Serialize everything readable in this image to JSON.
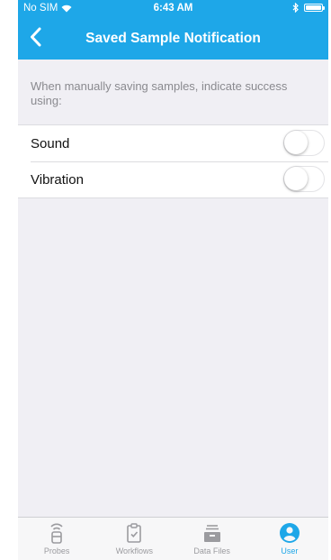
{
  "statusbar": {
    "carrier": "No SIM",
    "time": "6:43 AM"
  },
  "navbar": {
    "title": "Saved Sample Notification"
  },
  "section": {
    "header": "When manually saving samples, indicate success using:"
  },
  "settings": [
    {
      "label": "Sound",
      "enabled": false
    },
    {
      "label": "Vibration",
      "enabled": false
    }
  ],
  "tabs": [
    {
      "label": "Probes",
      "icon": "probe-icon",
      "active": false
    },
    {
      "label": "Workflows",
      "icon": "clipboard-icon",
      "active": false
    },
    {
      "label": "Data Files",
      "icon": "files-icon",
      "active": false
    },
    {
      "label": "User",
      "icon": "user-icon",
      "active": true
    }
  ],
  "colors": {
    "accent": "#1ea7e8",
    "background": "#f0eff4",
    "inactive_tab": "#9b9b9f"
  }
}
